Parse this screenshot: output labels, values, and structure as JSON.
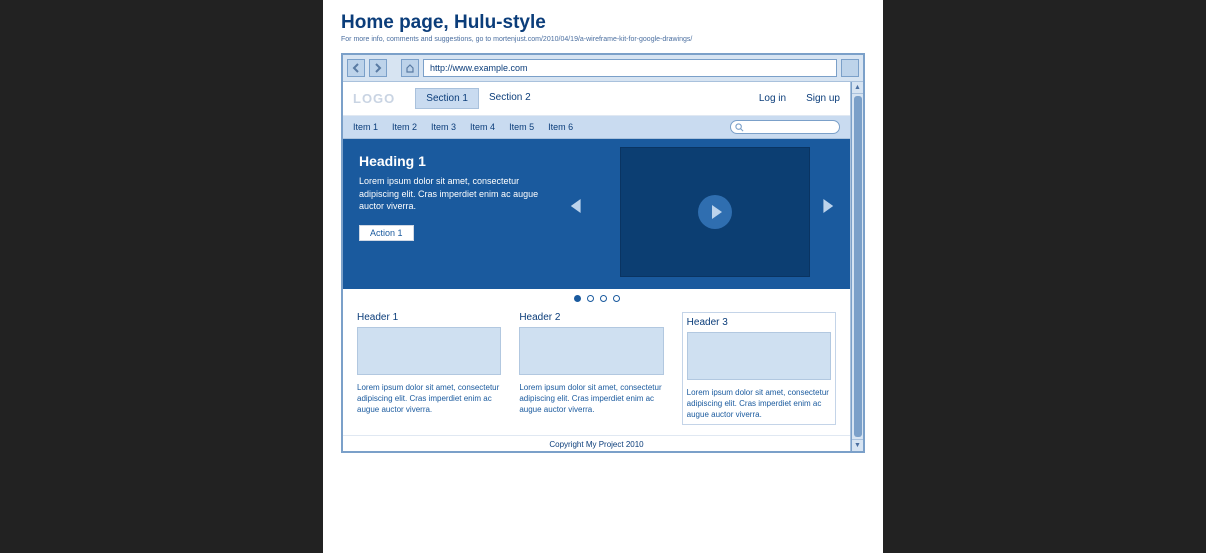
{
  "doc": {
    "title": "Home page, Hulu-style",
    "subtitle": "For more info, comments and suggestions, go to mortenjust.com/2010/04/19/a-wireframe-kit-for-google-drawings/"
  },
  "browser": {
    "url": "http://www.example.com"
  },
  "header": {
    "logo": "LOGO",
    "sections": [
      "Section 1",
      "Section 2"
    ],
    "login": "Log in",
    "signup": "Sign up"
  },
  "subnav": {
    "items": [
      "Item 1",
      "Item 2",
      "Item 3",
      "Item 4",
      "Item 5",
      "Item 6"
    ]
  },
  "hero": {
    "title": "Heading 1",
    "text": "Lorem ipsum dolor sit amet, consectetur adipiscing elit. Cras imperdiet enim ac augue auctor viverra.",
    "action": "Action 1"
  },
  "cards": [
    {
      "header": "Header 1",
      "text": "Lorem ipsum dolor sit amet, consectetur adipiscing elit. Cras imperdiet enim ac augue auctor viverra."
    },
    {
      "header": "Header 2",
      "text": "Lorem ipsum dolor sit amet, consectetur adipiscing elit. Cras imperdiet enim ac augue auctor viverra."
    },
    {
      "header": "Header 3",
      "text": "Lorem ipsum dolor sit amet, consectetur adipiscing elit. Cras imperdiet enim ac augue auctor viverra."
    }
  ],
  "footer": {
    "text": "Copyright My Project 2010"
  }
}
